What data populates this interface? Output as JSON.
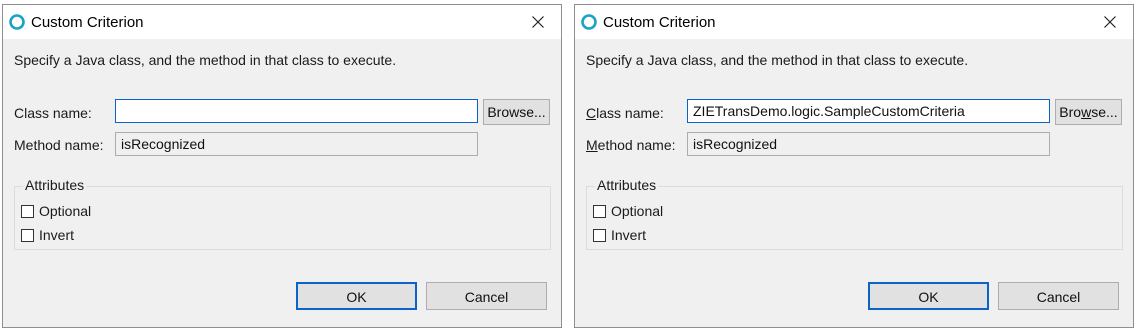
{
  "dialogs": [
    {
      "title": "Custom Criterion",
      "description": "Specify a Java class, and the method in that class to execute.",
      "class_label": "Class name:",
      "class_value": "",
      "method_label": "Method name:",
      "method_value": "isRecognized",
      "browse_label": "Browse...",
      "group_title": "Attributes",
      "optional_label": "Optional",
      "invert_label": "Invert",
      "ok_label": "OK",
      "cancel_label": "Cancel",
      "optional_checked": false,
      "invert_checked": false
    },
    {
      "title": "Custom Criterion",
      "description": "Specify a Java class, and the method in that class to execute.",
      "class_label_mnemonic": "C",
      "class_label_rest": "lass name:",
      "class_value": "ZIETransDemo.logic.SampleCustomCriteria",
      "method_label_mnemonic": "M",
      "method_label_rest": "ethod name:",
      "method_value": "isRecognized",
      "browse_label_a": "Bro",
      "browse_label_mnemonic": "w",
      "browse_label_b": "se...",
      "group_title": "Attributes",
      "optional_label": "Optional",
      "invert_label": "Invert",
      "ok_label": "OK",
      "cancel_label": "Cancel",
      "optional_checked": false,
      "invert_checked": false
    }
  ],
  "icons": {
    "app_icon": "circle-ring-icon",
    "close_icon": "close-icon"
  },
  "colors": {
    "accent": "#0a64c8",
    "app_icon": "#1aa3c4",
    "dialog_bg": "#f0f0f0"
  }
}
